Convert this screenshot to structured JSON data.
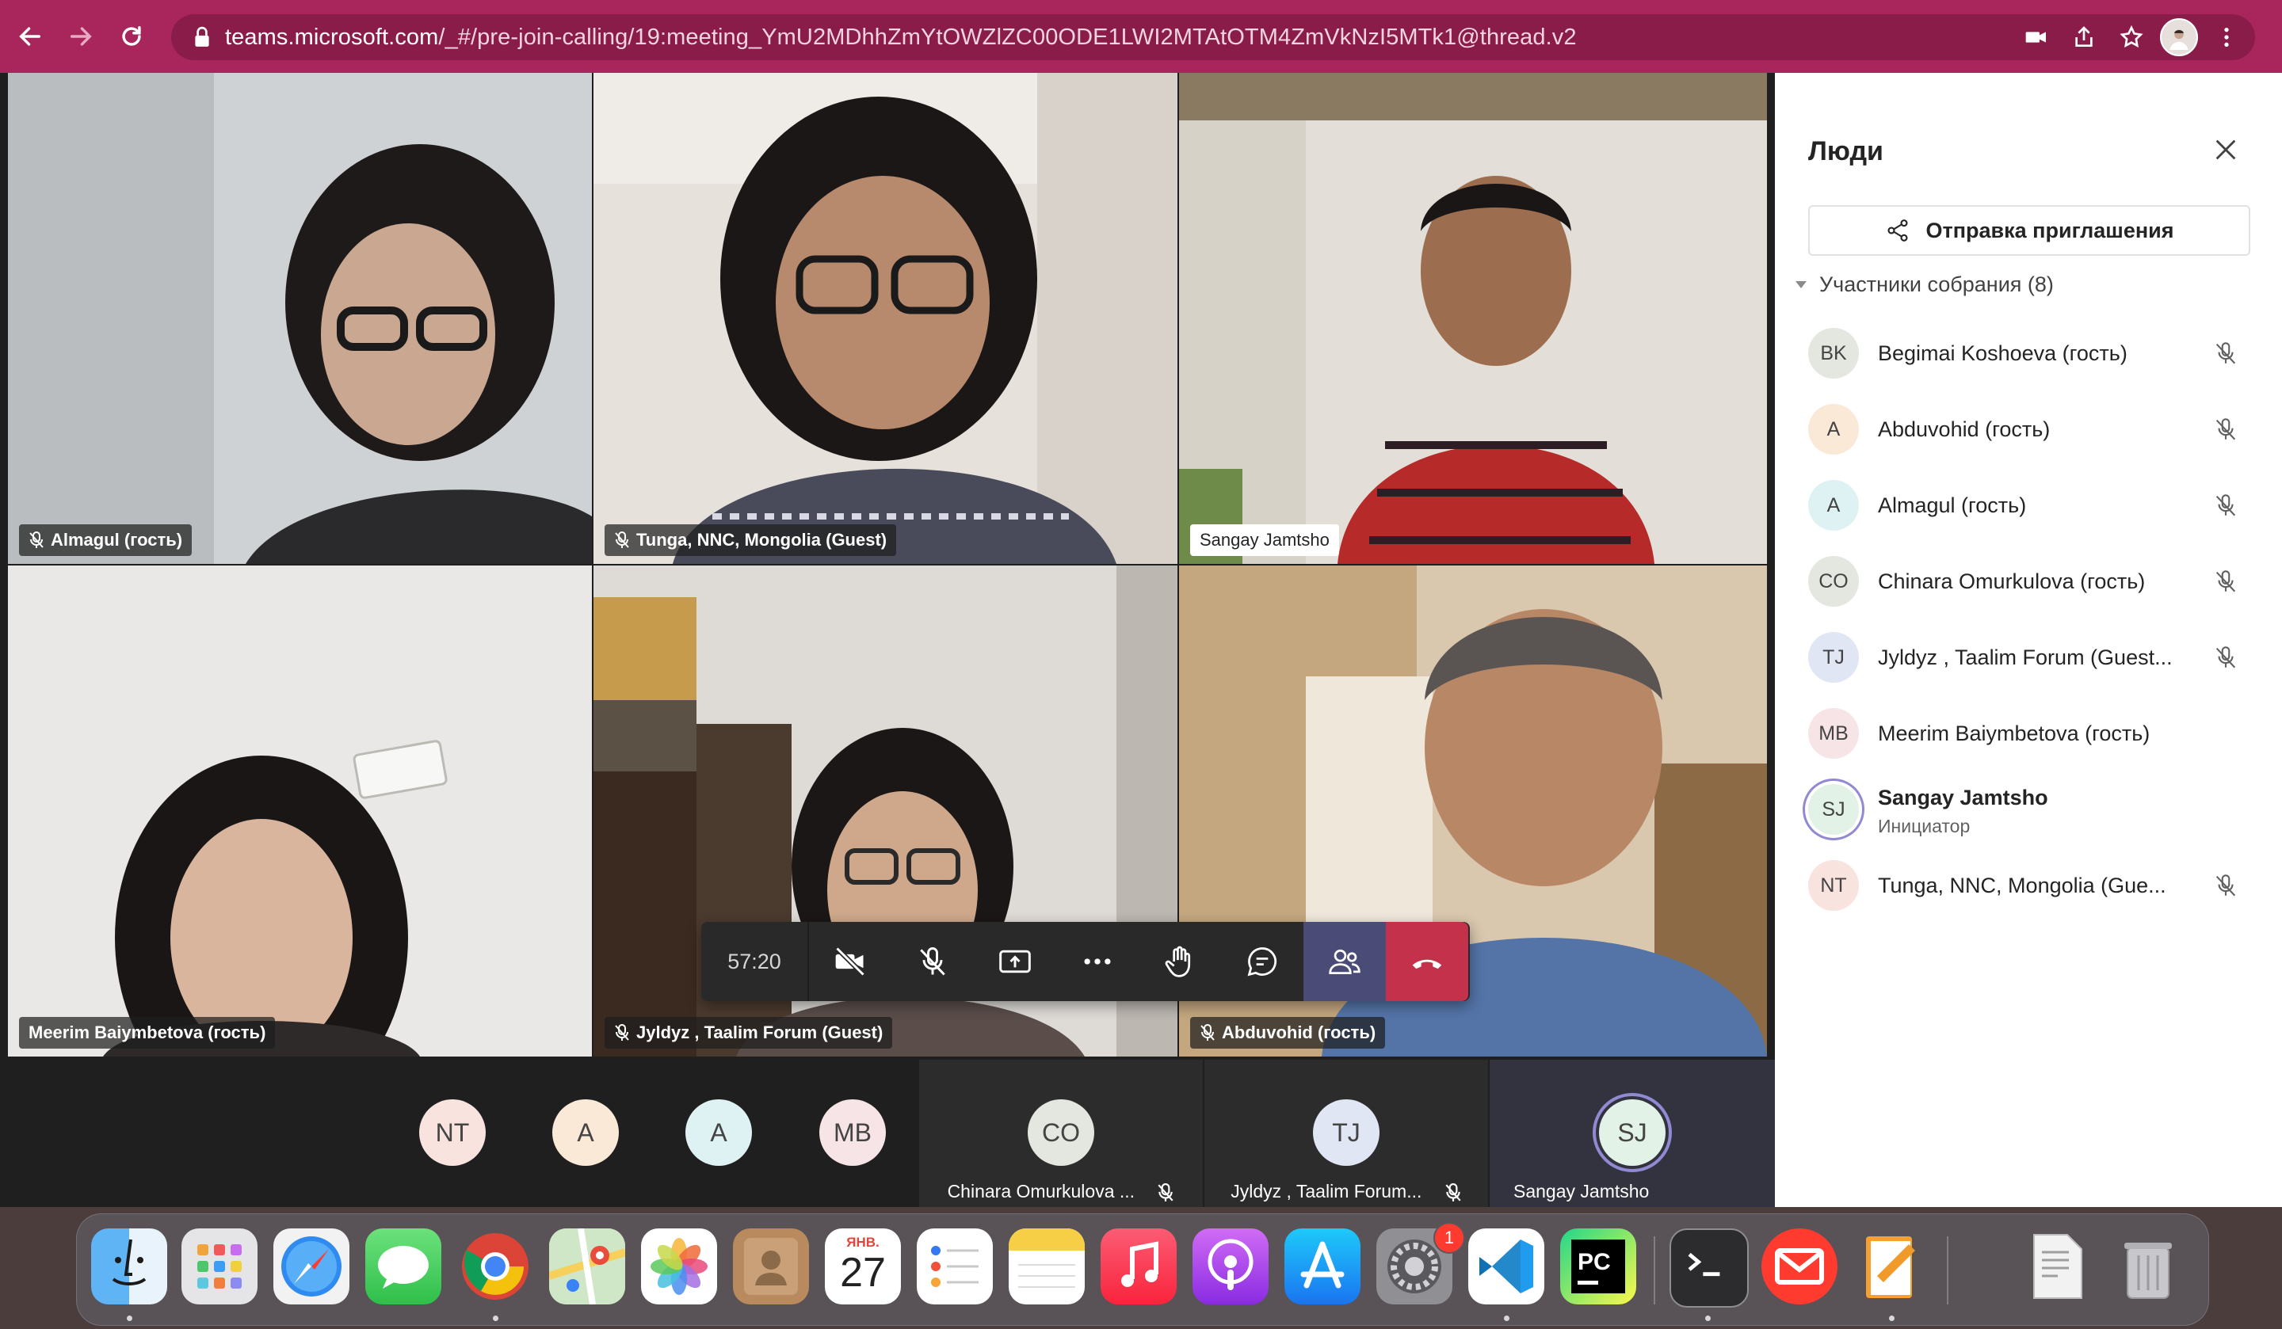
{
  "browser": {
    "url_host": "teams.microsoft.com",
    "url_path": "/_#/pre-join-calling/19:meeting_YmU2MDhhZmYtOWZlZC00ODE1LWI2MTAtOTM4ZmVkNzI5MTk1@thread.v2"
  },
  "tiles": [
    {
      "name": "Almagul (гость)",
      "muted": true
    },
    {
      "name": "Tunga, NNC, Mongolia (Guest)",
      "muted": true
    },
    {
      "name": "Sangay Jamtsho",
      "muted": false
    },
    {
      "name": "Meerim Baiymbetova (гость)",
      "muted": false
    },
    {
      "name": "Jyldyz , Taalim Forum (Guest)",
      "muted": true
    },
    {
      "name": "Abduvohid (гость)",
      "muted": true
    }
  ],
  "controls": {
    "timer": "57:20"
  },
  "bottom_row": {
    "avatars": [
      "NT",
      "A",
      "A",
      "MB"
    ],
    "cells": [
      {
        "initials": "CO",
        "name": "Chinara Omurkulova ..."
      },
      {
        "initials": "TJ",
        "name": "Jyldyz , Taalim Forum..."
      },
      {
        "initials": "SJ",
        "name": "Sangay Jamtsho"
      }
    ]
  },
  "panel": {
    "title": "Люди",
    "invite_label": "Отправка приглашения",
    "section_label": "Участники собрания (8)",
    "participants": [
      {
        "initials": "BK",
        "name": "Begimai Koshoeva (гость)",
        "color": "#e3e7e0",
        "muted": true
      },
      {
        "initials": "A",
        "name": "Abduvohid (гость)",
        "color": "#fbe9d8",
        "muted": true
      },
      {
        "initials": "A",
        "name": "Almagul (гость)",
        "color": "#dff2f3",
        "muted": true
      },
      {
        "initials": "CO",
        "name": "Chinara Omurkulova (гость)",
        "color": "#e3e7e0",
        "muted": true
      },
      {
        "initials": "TJ",
        "name": "Jyldyz , Taalim Forum (Guest...",
        "color": "#e1e6f4",
        "muted": true
      },
      {
        "initials": "MB",
        "name": "Meerim Baiymbetova (гость)",
        "color": "#f6e4e6",
        "muted": false
      },
      {
        "initials": "SJ",
        "name": "Sangay Jamtsho",
        "sub": "Инициатор",
        "color": "#e3f2e7",
        "muted": false
      },
      {
        "initials": "NT",
        "name": "Tunga, NNC, Mongolia (Gue...",
        "color": "#f8e3df",
        "muted": true
      }
    ]
  },
  "dock": {
    "calendar_month": "ЯНВ.",
    "calendar_day": "27",
    "settings_badge": "1",
    "apps": [
      "finder-icon",
      "launchpad-icon",
      "safari-icon",
      "messages-icon",
      "chrome-icon",
      "maps-icon",
      "photos-icon",
      "contacts-icon",
      "calendar-icon",
      "reminders-icon",
      "notes-icon",
      "music-icon",
      "podcasts-icon",
      "app-store-icon",
      "system-preferences-icon",
      "vscode-icon",
      "pycharm-icon",
      "terminal-icon",
      "mail-icon",
      "pages-icon",
      "document-icon",
      "trash-icon"
    ]
  }
}
